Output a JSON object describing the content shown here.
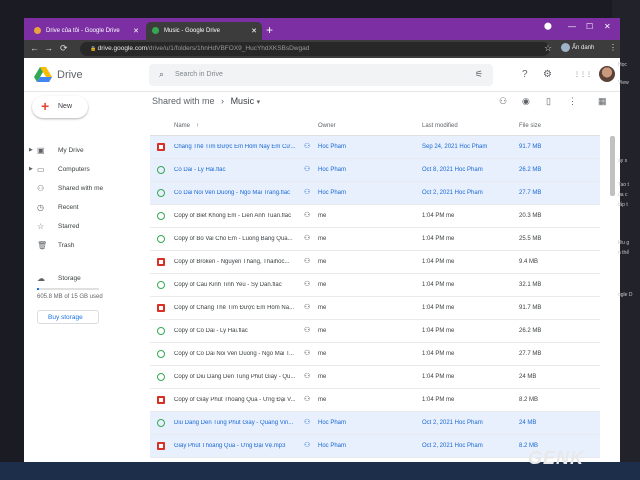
{
  "desktop_side": [
    "Học",
    "View",
    "ày s",
    "Tao t",
    "ủa c",
    "tấp t",
    "Iêu g",
    "n thể",
    "ogle D"
  ],
  "browser": {
    "tabs": [
      {
        "label": "Drive của tôi - Google Drive",
        "active": false
      },
      {
        "label": "Music - Google Drive",
        "active": true
      }
    ],
    "new_tab": "+",
    "url_host": "drive.google.com",
    "url_path": "/drive/u/1/folders/1hnHdVBFOX9_HucYhdXKSBsDwgad",
    "profile_label": "Ẩn danh",
    "win_minimize": "—",
    "win_maximize": "☐",
    "win_close": "✕",
    "nav_back": "←",
    "nav_forward": "→",
    "nav_reload": "⟳",
    "menu": "⋮",
    "star": "☆",
    "lock": "🔒"
  },
  "app": {
    "brand": "Drive",
    "search_placeholder": "Search in Drive",
    "icons": {
      "search": "⌕",
      "tune": "⚟",
      "help": "?",
      "settings": "⚙",
      "apps": "⋮⋮⋮"
    }
  },
  "sidebar": {
    "new_label": "New",
    "items": [
      {
        "label": "My Drive",
        "icon": "drive-icon",
        "glyph": "▣",
        "arrow": true
      },
      {
        "label": "Computers",
        "icon": "computer-icon",
        "glyph": "▭",
        "arrow": true
      },
      {
        "label": "Shared with me",
        "icon": "people-icon",
        "glyph": "⚇",
        "arrow": false
      },
      {
        "label": "Recent",
        "icon": "clock-icon",
        "glyph": "◷",
        "arrow": false
      },
      {
        "label": "Starred",
        "icon": "star-icon",
        "glyph": "☆",
        "arrow": false
      },
      {
        "label": "Trash",
        "icon": "trash-icon",
        "glyph": "🗑",
        "arrow": false
      }
    ],
    "storage_label": "Storage",
    "storage_text": "605.8 MB of 15 GB used",
    "storage_fraction": 0.04,
    "buy_label": "Buy storage"
  },
  "main": {
    "crumb_root": "Shared with me",
    "crumb_sep": "›",
    "crumb_current": "Music",
    "crumb_dropdown": "▾",
    "columns": {
      "name": "Name",
      "sort": "↑",
      "owner": "Owner",
      "modified": "Last modified",
      "size": "File size"
    },
    "rows": [
      {
        "type": "pdf",
        "name": "Chẳng Thể Tìm Được Em Hôm Nay Em Cư...",
        "shared": true,
        "owner": "Hoc Pham",
        "modified": "Sep 24, 2021 Hoc Pham",
        "size": "91.7 MB",
        "selected": true
      },
      {
        "type": "audio",
        "name": "Co Dai - Ly Hai.flac",
        "shared": true,
        "owner": "Hoc Pham",
        "modified": "Oct 8, 2021 Hoc Pham",
        "size": "26.2 MB",
        "selected": true
      },
      {
        "type": "audio",
        "name": "Co Dai Noi Ven Duong - Ngo Mai Trang.flac",
        "shared": true,
        "owner": "Hoc Pham",
        "modified": "Oct 2, 2021 Hoc Pham",
        "size": "27.7 MB",
        "selected": true
      },
      {
        "type": "audio",
        "name": "Copy of Biet Khong Em - Lien Anh Tuan.flac",
        "shared": true,
        "owner": "me",
        "modified": "1:04 PM me",
        "size": "20.3 MB",
        "selected": false
      },
      {
        "type": "audio",
        "name": "Copy of Bo Vai Cho Em - Luong Bang Qua...",
        "shared": true,
        "owner": "me",
        "modified": "1:04 PM me",
        "size": "25.5 MB",
        "selected": false
      },
      {
        "type": "pdf",
        "name": "Copy of Broken - Nguyen Thang, Thaihoc...",
        "shared": true,
        "owner": "me",
        "modified": "1:04 PM me",
        "size": "9.4 MB",
        "selected": false
      },
      {
        "type": "audio",
        "name": "Copy of Cau Kinh Tinh Yeu - Sy Dan.flac",
        "shared": true,
        "owner": "me",
        "modified": "1:04 PM me",
        "size": "32.1 MB",
        "selected": false
      },
      {
        "type": "pdf",
        "name": "Copy of Chẳng Thể Tìm Được Em Hôm Na...",
        "shared": true,
        "owner": "me",
        "modified": "1:04 PM me",
        "size": "91.7 MB",
        "selected": false
      },
      {
        "type": "audio",
        "name": "Copy of Co Dai - Ly Hai.flac",
        "shared": true,
        "owner": "me",
        "modified": "1:04 PM me",
        "size": "26.2 MB",
        "selected": false
      },
      {
        "type": "audio",
        "name": "Copy of Co Dai Noi Ven Duong - Ngo Mai T...",
        "shared": true,
        "owner": "me",
        "modified": "1:04 PM me",
        "size": "27.7 MB",
        "selected": false
      },
      {
        "type": "audio",
        "name": "Copy of Diu Dang Den Tung Phut Giay - Qu...",
        "shared": true,
        "owner": "me",
        "modified": "1:04 PM me",
        "size": "24 MB",
        "selected": false
      },
      {
        "type": "pdf",
        "name": "Copy of Giây Phút Thoáng Qua - Ưng Đại V...",
        "shared": true,
        "owner": "me",
        "modified": "1:04 PM me",
        "size": "8.2 MB",
        "selected": false
      },
      {
        "type": "audio",
        "name": "Diu Dang Den Tung Phut Giay - Quang Vin...",
        "shared": true,
        "owner": "Hoc Pham",
        "modified": "Oct 2, 2021 Hoc Pham",
        "size": "24 MB",
        "selected": true
      },
      {
        "type": "pdf",
        "name": "Giây Phút Thoáng Qua - Ưng Đại Vệ.mp3",
        "shared": true,
        "owner": "Hoc Pham",
        "modified": "Oct 2, 2021 Hoc Pham",
        "size": "8.2 MB",
        "selected": true
      }
    ]
  },
  "watermark": "GENK",
  "colors": {
    "accent": "#1a73e8",
    "selected_row": "#e8f0fe",
    "titlebar": "#7b2fa3"
  }
}
